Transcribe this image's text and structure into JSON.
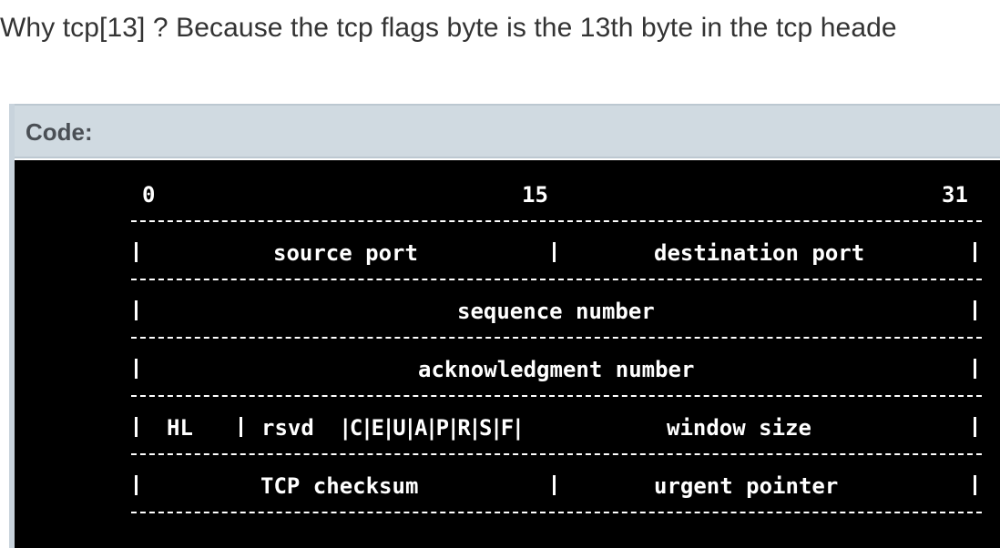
{
  "intro_text": "Why tcp[13] ? Because the tcp flags byte is the 13th byte in the tcp heade",
  "code_label": "Code:",
  "diagram": {
    "bit_0": "0",
    "bit_15": "15",
    "bit_31": "31",
    "row1_left": "source port",
    "row1_right": "destination port",
    "row2": "sequence number",
    "row3": "acknowledgment number",
    "row4_hl": "HL",
    "row4_rsvd": "rsvd",
    "row4_flags": "|C|E|U|A|P|R|S|F|",
    "row4_window": "window size",
    "row5_left": "TCP checksum",
    "row5_right": "urgent pointer"
  },
  "colors": {
    "header_bg": "#d0dae1",
    "code_bg": "#000000",
    "code_fg": "#ffffff",
    "text": "#333333"
  }
}
